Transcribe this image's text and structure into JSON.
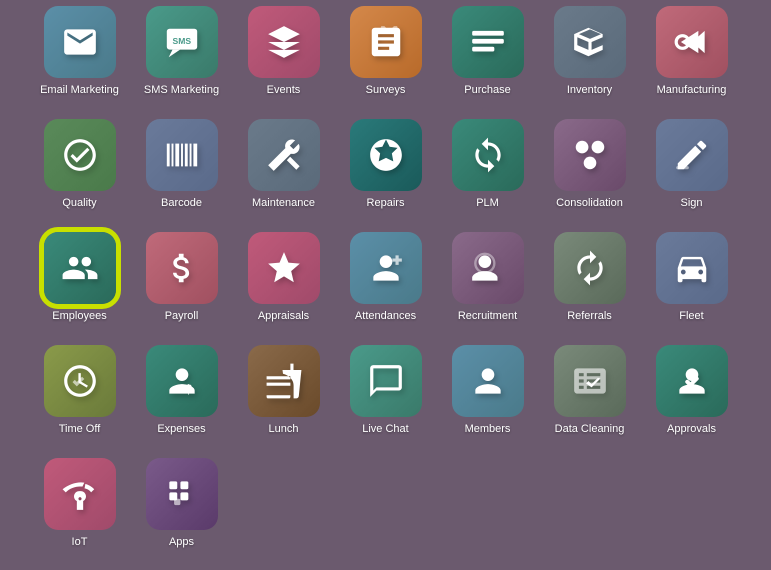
{
  "apps": [
    {
      "id": "email-marketing",
      "label": "Email Marketing",
      "color": "c-blue-teal",
      "icon": "email"
    },
    {
      "id": "sms-marketing",
      "label": "SMS Marketing",
      "color": "c-teal",
      "icon": "sms"
    },
    {
      "id": "events",
      "label": "Events",
      "color": "c-pink",
      "icon": "events"
    },
    {
      "id": "surveys",
      "label": "Surveys",
      "color": "c-orange",
      "icon": "surveys"
    },
    {
      "id": "purchase",
      "label": "Purchase",
      "color": "c-teal2",
      "icon": "purchase"
    },
    {
      "id": "inventory",
      "label": "Inventory",
      "color": "c-gray-blue",
      "icon": "inventory"
    },
    {
      "id": "manufacturing",
      "label": "Manufacturing",
      "color": "c-rose",
      "icon": "manufacturing"
    },
    {
      "id": "quality",
      "label": "Quality",
      "color": "c-green",
      "icon": "quality"
    },
    {
      "id": "barcode",
      "label": "Barcode",
      "color": "c-steel",
      "icon": "barcode"
    },
    {
      "id": "maintenance",
      "label": "Maintenance",
      "color": "c-gray-blue",
      "icon": "maintenance"
    },
    {
      "id": "repairs",
      "label": "Repairs",
      "color": "c-dark-teal",
      "icon": "repairs"
    },
    {
      "id": "plm",
      "label": "PLM",
      "color": "c-teal2",
      "icon": "plm"
    },
    {
      "id": "consolidation",
      "label": "Consolidation",
      "color": "c-mauve",
      "icon": "consolidation"
    },
    {
      "id": "sign",
      "label": "Sign",
      "color": "c-steel",
      "icon": "sign"
    },
    {
      "id": "employees",
      "label": "Employees",
      "color": "c-teal2",
      "icon": "employees",
      "highlighted": true
    },
    {
      "id": "payroll",
      "label": "Payroll",
      "color": "c-rose",
      "icon": "payroll"
    },
    {
      "id": "appraisals",
      "label": "Appraisals",
      "color": "c-pink",
      "icon": "appraisals"
    },
    {
      "id": "attendances",
      "label": "Attendances",
      "color": "c-blue-teal",
      "icon": "attendances"
    },
    {
      "id": "recruitment",
      "label": "Recruitment",
      "color": "c-mauve",
      "icon": "recruitment"
    },
    {
      "id": "referrals",
      "label": "Referrals",
      "color": "c-slate",
      "icon": "referrals"
    },
    {
      "id": "fleet",
      "label": "Fleet",
      "color": "c-steel",
      "icon": "fleet"
    },
    {
      "id": "time-off",
      "label": "Time Off",
      "color": "c-olive",
      "icon": "timeoff"
    },
    {
      "id": "expenses",
      "label": "Expenses",
      "color": "c-teal2",
      "icon": "expenses"
    },
    {
      "id": "lunch",
      "label": "Lunch",
      "color": "c-brown",
      "icon": "lunch"
    },
    {
      "id": "live-chat",
      "label": "Live Chat",
      "color": "c-teal",
      "icon": "livechat"
    },
    {
      "id": "members",
      "label": "Members",
      "color": "c-blue-teal",
      "icon": "members"
    },
    {
      "id": "data-cleaning",
      "label": "Data Cleaning",
      "color": "c-slate",
      "icon": "datacleaning"
    },
    {
      "id": "approvals",
      "label": "Approvals",
      "color": "c-teal2",
      "icon": "approvals"
    },
    {
      "id": "iot",
      "label": "IoT",
      "color": "c-pink",
      "icon": "iot"
    },
    {
      "id": "apps",
      "label": "Apps",
      "color": "c-plum",
      "icon": "apps"
    }
  ]
}
